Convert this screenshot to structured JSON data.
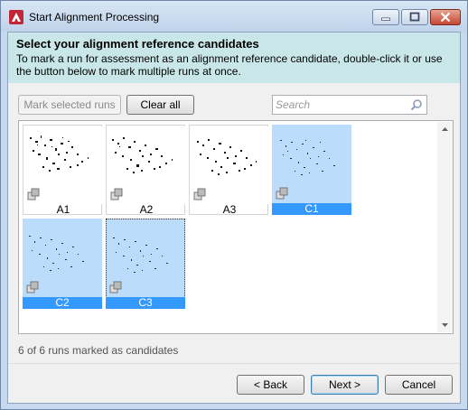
{
  "window": {
    "title": "Start Alignment Processing",
    "controls": [
      "minimize-icon",
      "maximize-icon",
      "close-icon"
    ]
  },
  "header": {
    "title": "Select your alignment reference candidates",
    "description": "To mark a run for assessment as an alignment reference candidate, double-click it or use the button below to mark multiple runs at once."
  },
  "toolbar": {
    "mark_selected_label": "Mark selected runs",
    "mark_selected_enabled": false,
    "clear_all_label": "Clear all",
    "search_placeholder": "Search",
    "search_value": ""
  },
  "runs": [
    {
      "label": "A1",
      "marked": false
    },
    {
      "label": "A2",
      "marked": false
    },
    {
      "label": "A3",
      "marked": false
    },
    {
      "label": "C1",
      "marked": true
    },
    {
      "label": "C2",
      "marked": true
    },
    {
      "label": "C3",
      "marked": true,
      "focused": true
    }
  ],
  "status": {
    "text": "6 of 6 runs marked as candidates"
  },
  "footer": {
    "back_label": "< Back",
    "next_label": "Next >",
    "cancel_label": "Cancel"
  },
  "colors": {
    "header_band": "#c9e7e8",
    "selection_fill": "#bcdcfb",
    "selection_caption": "#3399ff"
  }
}
